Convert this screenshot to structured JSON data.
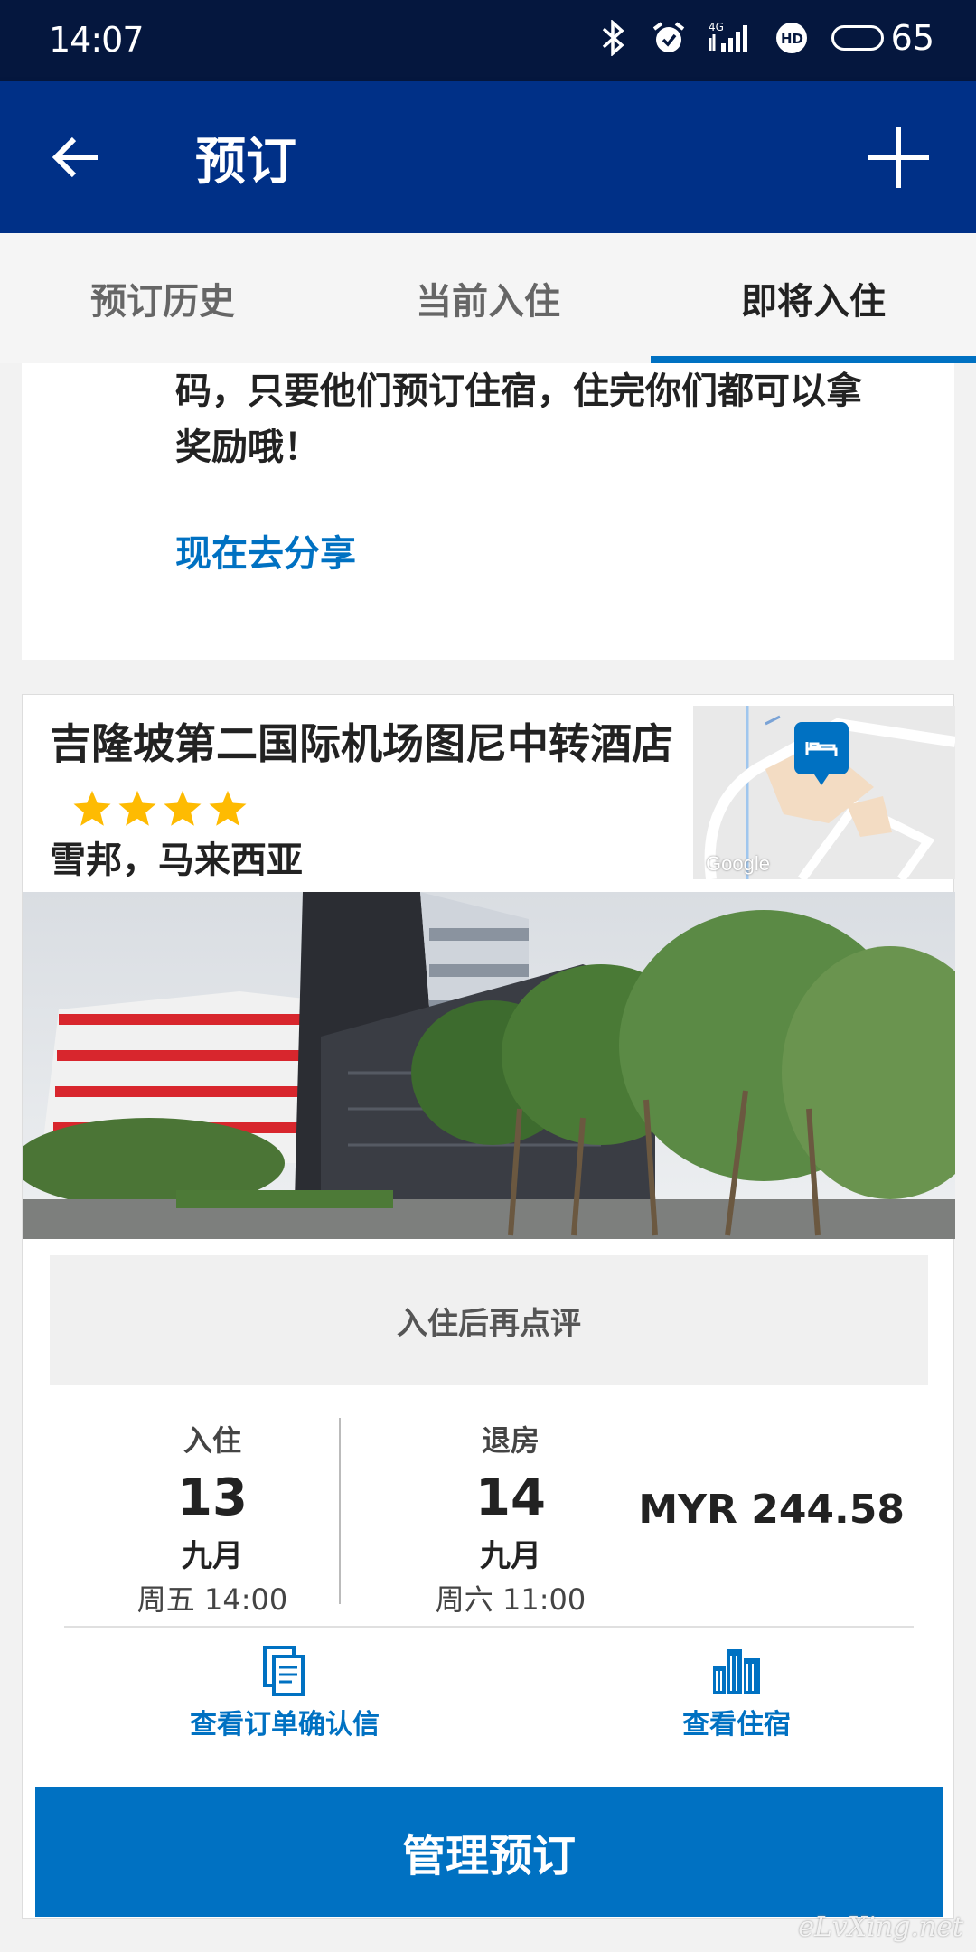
{
  "status_bar": {
    "time": "14:07",
    "battery": "65",
    "network": "4G"
  },
  "app_bar": {
    "title": "预订"
  },
  "tabs": [
    {
      "label": "预订历史",
      "active": false
    },
    {
      "label": "当前入住",
      "active": false
    },
    {
      "label": "即将入住",
      "active": true
    }
  ],
  "share": {
    "text": "码，只要他们预订住宿，住完你们都可以拿奖励哦！",
    "link": "现在去分享"
  },
  "hotel": {
    "name": "吉隆坡第二国际机场图尼中转酒店",
    "stars": 4,
    "location": "雪邦，马来西亚",
    "map_label": "Google",
    "review_note": "入住后再点评",
    "checkin": {
      "label": "入住",
      "day": "13",
      "month": "九月",
      "time": "周五 14:00"
    },
    "checkout": {
      "label": "退房",
      "day": "14",
      "month": "九月",
      "time": "周六 11:00"
    },
    "price": "MYR 244.58",
    "actions": {
      "confirmation": "查看订单确认信",
      "view_property": "查看住宿"
    },
    "manage_button": "管理预订"
  },
  "watermark": "eLvXing.net",
  "colors": {
    "status_bar": "#05173e",
    "app_bar": "#003087",
    "accent": "#0071c2",
    "star": "#febb02"
  }
}
